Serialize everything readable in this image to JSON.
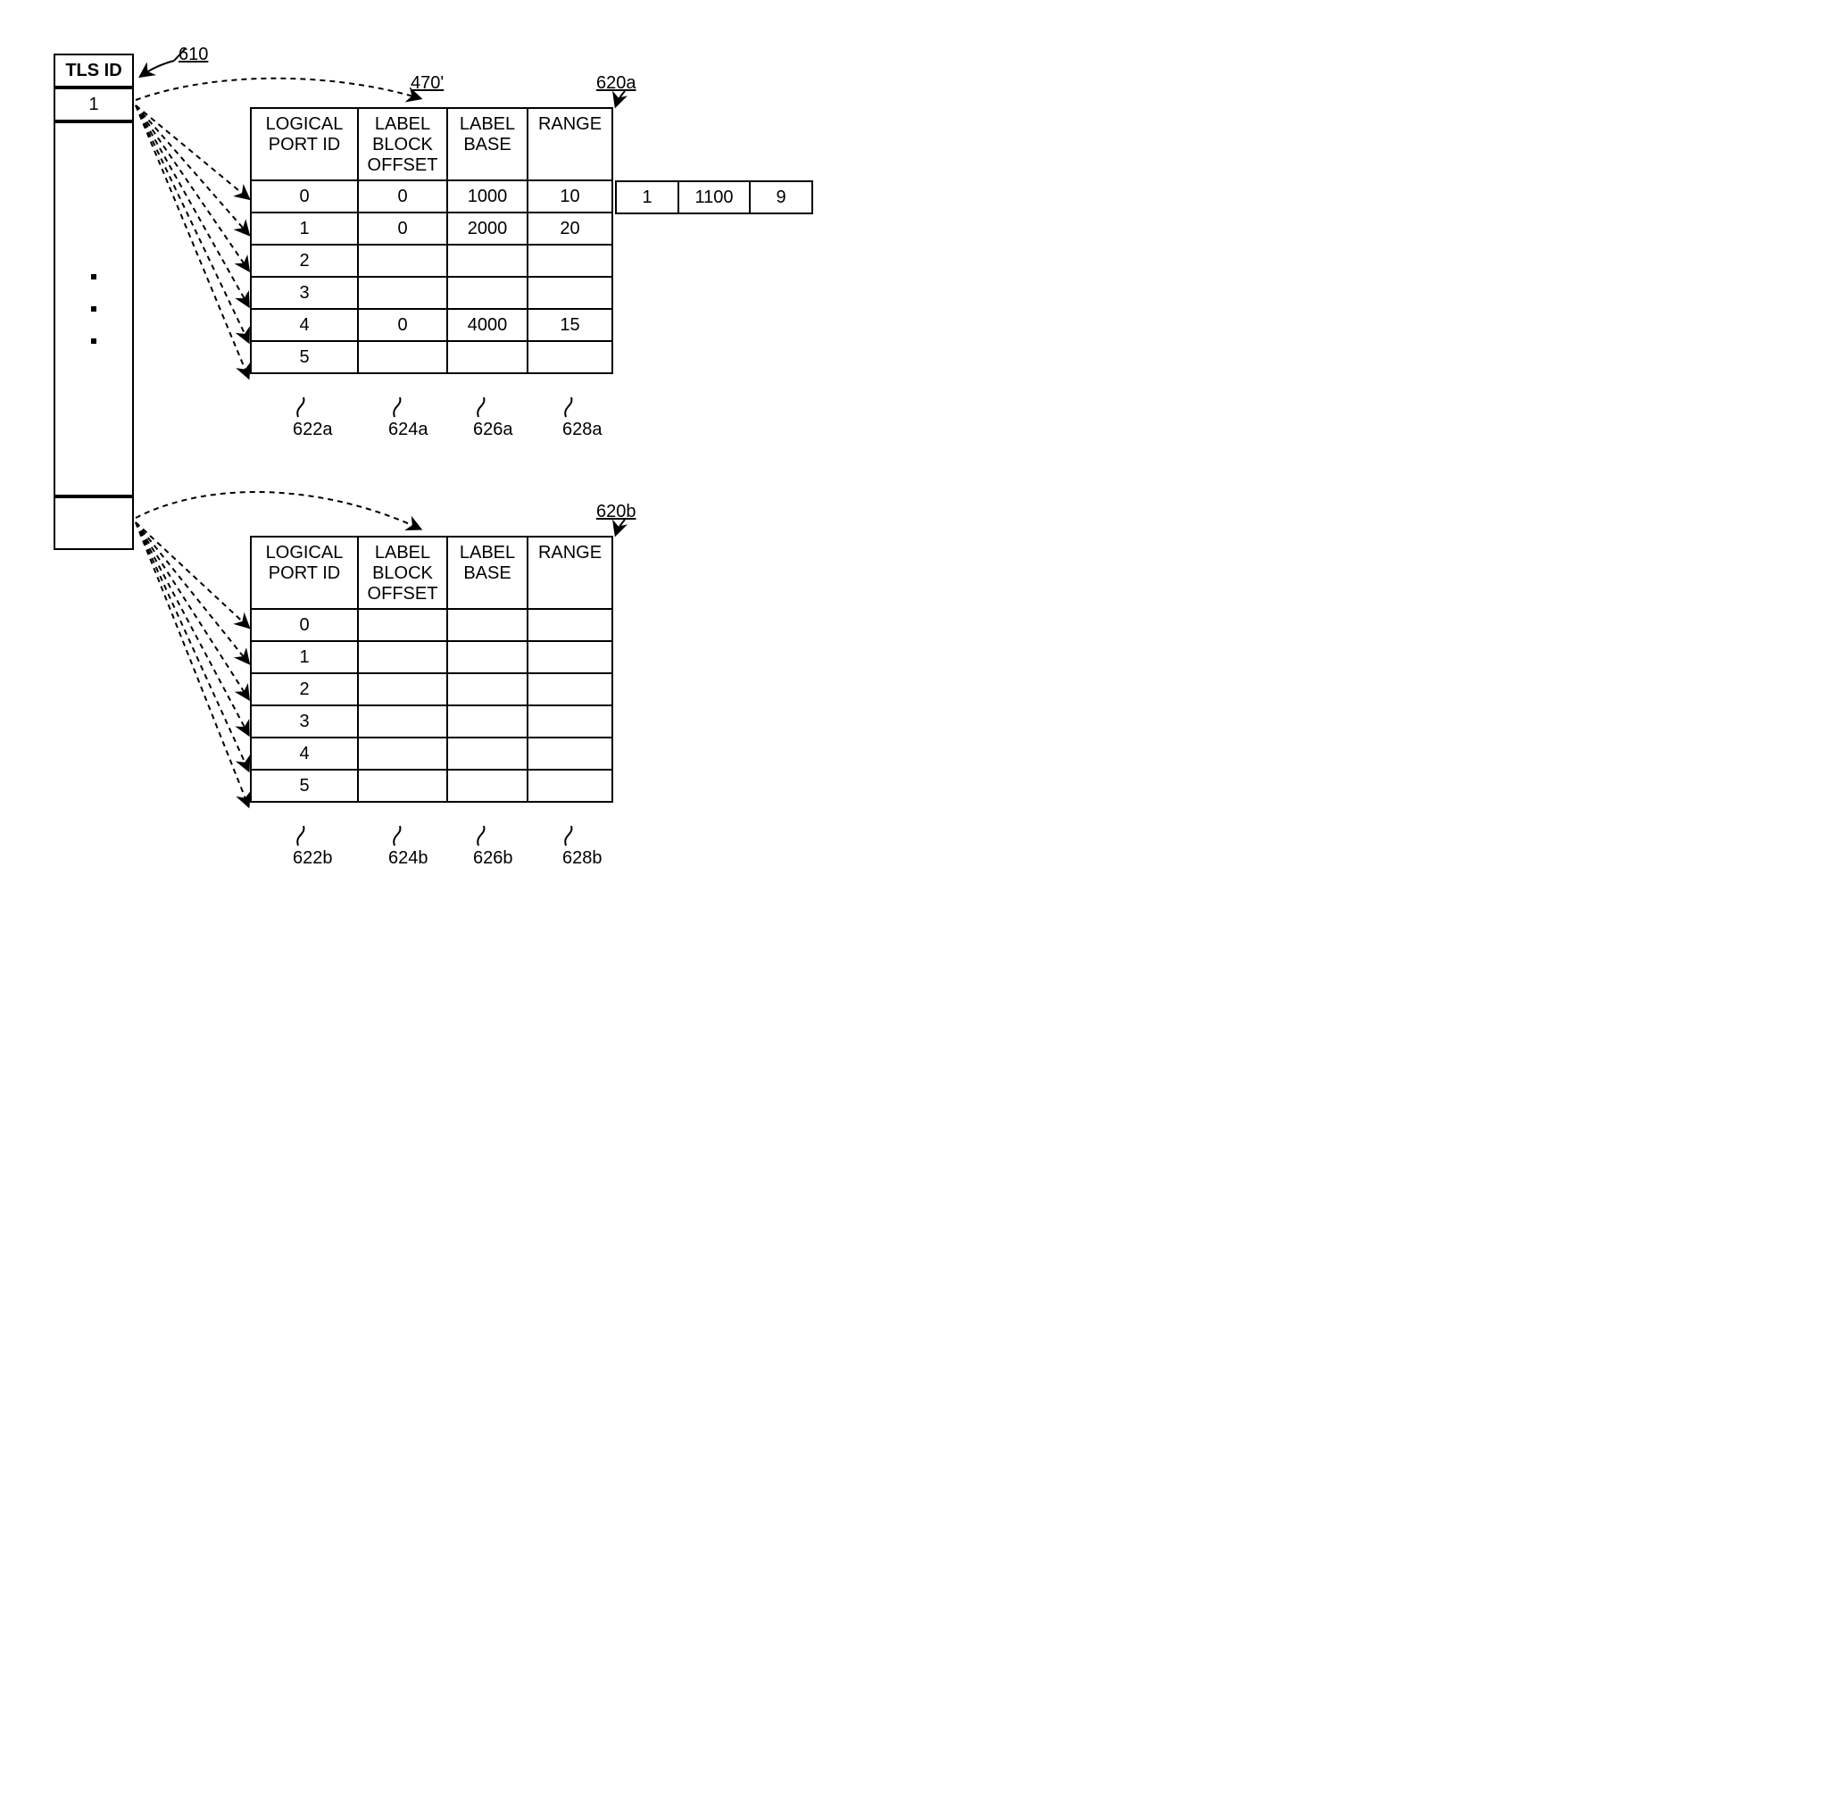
{
  "tls": {
    "header": "TLS ID",
    "first": "1"
  },
  "ref": {
    "r610": "610",
    "r470p": "470'",
    "r620a": "620a",
    "r620b": "620b",
    "r622a": "622a",
    "r624a": "624a",
    "r626a": "626a",
    "r628a": "628a",
    "r622b": "622b",
    "r624b": "624b",
    "r626b": "626b",
    "r628b": "628b"
  },
  "headers": {
    "port": "LOGICAL PORT ID",
    "offset": "LABEL BLOCK OFFSET",
    "base": "LABEL BASE",
    "range": "RANGE"
  },
  "chart_data": {
    "type": "table",
    "table_a": {
      "columns": [
        "LOGICAL PORT ID",
        "LABEL BLOCK OFFSET",
        "LABEL BASE",
        "RANGE"
      ],
      "rows": [
        {
          "port": "0",
          "offset": "0",
          "base": "1000",
          "range": "10"
        },
        {
          "port": "1",
          "offset": "0",
          "base": "2000",
          "range": "20"
        },
        {
          "port": "2",
          "offset": "",
          "base": "",
          "range": ""
        },
        {
          "port": "3",
          "offset": "",
          "base": "",
          "range": ""
        },
        {
          "port": "4",
          "offset": "0",
          "base": "4000",
          "range": "15"
        },
        {
          "port": "5",
          "offset": "",
          "base": "",
          "range": ""
        }
      ],
      "extension_row0": {
        "offset": "1",
        "base": "1100",
        "range": "9"
      }
    },
    "table_b": {
      "columns": [
        "LOGICAL PORT ID",
        "LABEL BLOCK OFFSET",
        "LABEL BASE",
        "RANGE"
      ],
      "rows": [
        {
          "port": "0",
          "offset": "",
          "base": "",
          "range": ""
        },
        {
          "port": "1",
          "offset": "",
          "base": "",
          "range": ""
        },
        {
          "port": "2",
          "offset": "",
          "base": "",
          "range": ""
        },
        {
          "port": "3",
          "offset": "",
          "base": "",
          "range": ""
        },
        {
          "port": "4",
          "offset": "",
          "base": "",
          "range": ""
        },
        {
          "port": "5",
          "offset": "",
          "base": "",
          "range": ""
        }
      ]
    }
  }
}
